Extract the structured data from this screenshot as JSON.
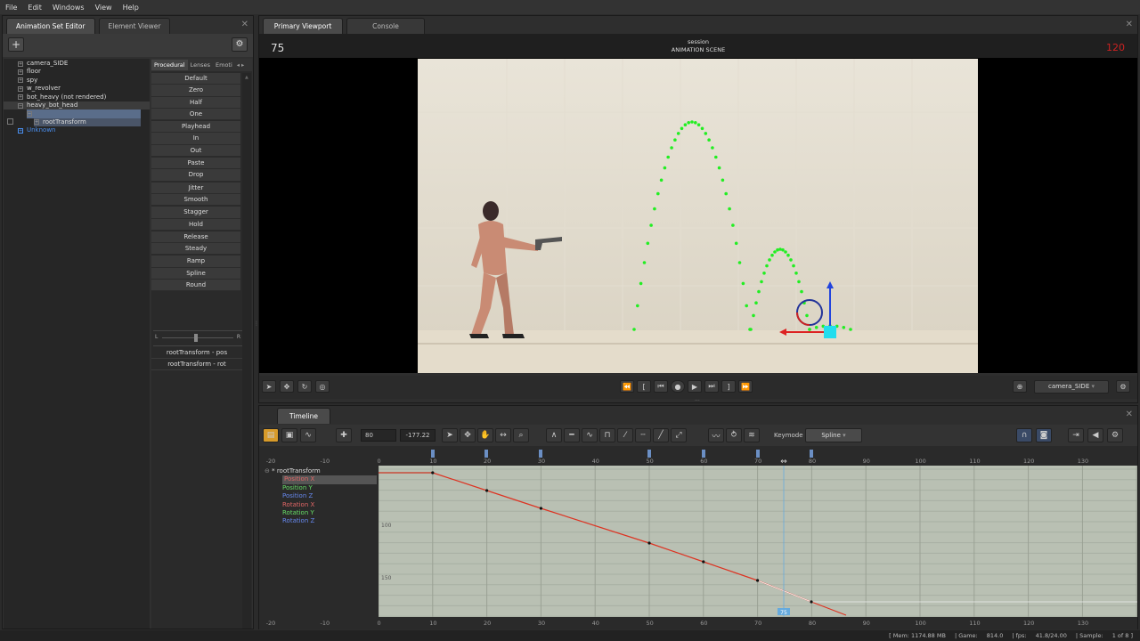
{
  "menu": {
    "items": [
      "File",
      "Edit",
      "Windows",
      "View",
      "Help"
    ]
  },
  "left_panel": {
    "tabs": [
      "Animation Set Editor",
      "Element Viewer"
    ],
    "tree": [
      {
        "label": "camera_SIDE"
      },
      {
        "label": "floor"
      },
      {
        "label": "spy"
      },
      {
        "label": "w_revolver"
      },
      {
        "label": "bot_heavy (not rendered)"
      },
      {
        "label": "heavy_bot_head"
      }
    ],
    "tree_child_selected": "",
    "tree_root_transform": "rootTransform",
    "tree_unknown": "Unknown"
  },
  "proc_panel": {
    "tabs": [
      "Procedural",
      "Lenses",
      "Emoti"
    ],
    "buttons": [
      "Default",
      "Zero",
      "Half",
      "One",
      "Playhead",
      "In",
      "Out",
      "Paste",
      "Drop",
      "Jitter",
      "Smooth",
      "Stagger",
      "Hold",
      "Release",
      "Steady",
      "Ramp",
      "Spline",
      "Round"
    ],
    "slider_left": "L",
    "slider_right": "R",
    "controls": [
      "rootTransform - pos",
      "rootTransform - rot"
    ]
  },
  "viewport": {
    "tabs": [
      "Primary Viewport",
      "Console"
    ],
    "frame": "75",
    "session": "session",
    "scene": "ANIMATION SCENE",
    "fps_counter": "120",
    "camera": "camera_SIDE"
  },
  "timeline": {
    "tab": "Timeline",
    "field_frame": "80",
    "field_value": "-177.22",
    "keymode_label": "Keymode",
    "keymode_value": "Spline",
    "ruler_ticks": [
      "-20",
      "-10",
      "0",
      "10",
      "20",
      "30",
      "40",
      "50",
      "60",
      "70",
      "80",
      "90",
      "100",
      "110",
      "120",
      "130"
    ],
    "value_labels": [
      "100",
      "150"
    ],
    "playhead": "75",
    "root_label": "rootTransform",
    "curves": [
      {
        "label": "Position X",
        "color": "#e06666"
      },
      {
        "label": "Position Y",
        "color": "#66dd66"
      },
      {
        "label": "Position Z",
        "color": "#6688ee"
      },
      {
        "label": "Rotation X",
        "color": "#e06666"
      },
      {
        "label": "Rotation Y",
        "color": "#66dd66"
      },
      {
        "label": "Rotation Z",
        "color": "#6688ee"
      }
    ]
  },
  "status": {
    "mem": "[ Mem: 1174.88 MB",
    "game": "| Game:",
    "game_val": "814.0",
    "fps": "| fps:",
    "fps_val": "41.8/24.00",
    "sample": "| Sample:",
    "page": "1 of 8 ]"
  }
}
